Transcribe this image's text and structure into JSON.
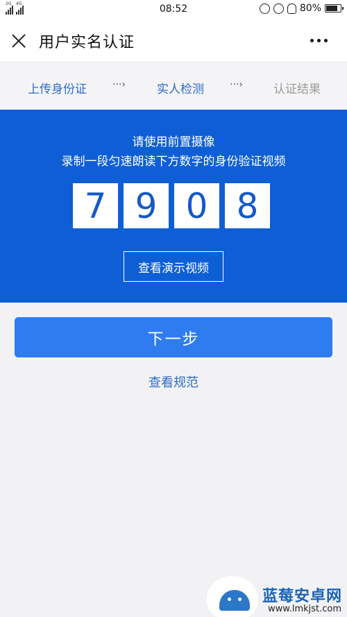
{
  "status_bar": {
    "network_labels": [
      "2G",
      "4G"
    ],
    "time": "08:52",
    "battery": "80%",
    "battery_level": 0.8,
    "icons": [
      "vibrate-icon",
      "rotation-lock-icon",
      "alarm-icon",
      "battery-icon"
    ]
  },
  "nav": {
    "title": "用户实名认证",
    "close_icon": "close-icon",
    "more_icon": "more-icon"
  },
  "steps": [
    {
      "label": "上传身份证",
      "state": "done"
    },
    {
      "label": "实人检测",
      "state": "active"
    },
    {
      "label": "认证结果",
      "state": "pending"
    }
  ],
  "step_arrow": "···›",
  "panel": {
    "instruction_line1": "请使用前置摄像",
    "instruction_line2": "录制一段匀速朗读下方数字的身份验证视频",
    "digits": [
      "7",
      "9",
      "0",
      "8"
    ],
    "demo_button": "查看演示视频"
  },
  "next_button": "下一步",
  "spec_link": "查看规范",
  "watermark": {
    "title": "蓝莓安卓网",
    "url": "www.lmkjst.com"
  },
  "colors": {
    "panel_blue": "#0e5fd6",
    "button_blue": "#2f7cf0",
    "link_blue": "#2e6bc7",
    "background": "#f2f2f4"
  }
}
